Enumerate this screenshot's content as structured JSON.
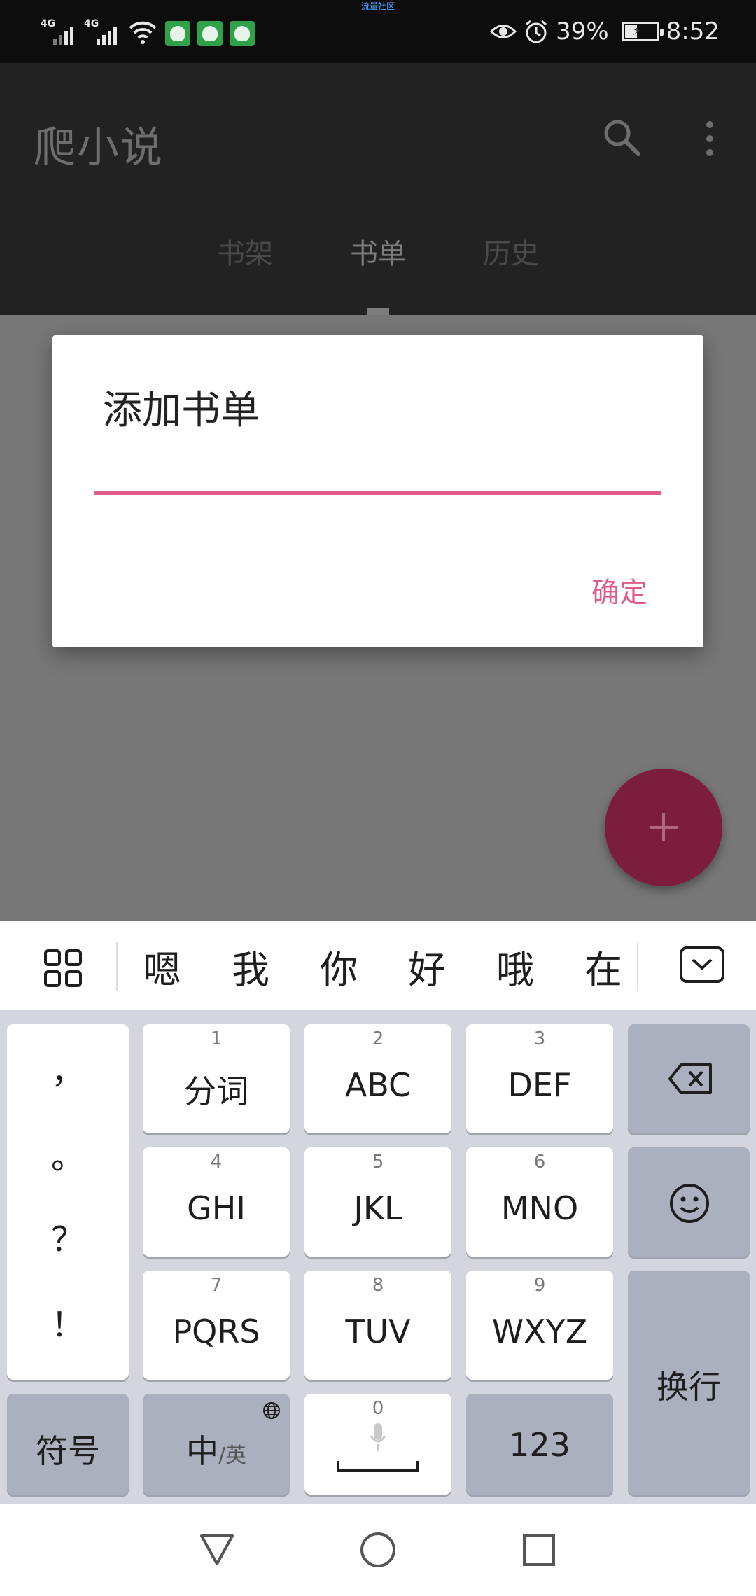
{
  "status_bar": {
    "network_1": "4G",
    "network_2": "4G",
    "center_text": "流量社区",
    "battery": "39%",
    "battery_level": 0.39,
    "time": "8:52"
  },
  "app_bar": {
    "title": "爬小说",
    "tabs": [
      {
        "label": "书架",
        "active": false
      },
      {
        "label": "书单",
        "active": true
      },
      {
        "label": "历史",
        "active": false
      }
    ]
  },
  "dialog": {
    "title": "添加书单",
    "input_value": "",
    "ok_label": "确定",
    "accent_color": "#e05a8a"
  },
  "ime": {
    "candidates": [
      "嗯",
      "我",
      "你",
      "好",
      "哦",
      "在"
    ],
    "punctuation": [
      "，",
      "。",
      "？",
      "！"
    ],
    "keys": [
      {
        "num": "1",
        "label": "分词"
      },
      {
        "num": "2",
        "label": "ABC"
      },
      {
        "num": "3",
        "label": "DEF"
      },
      {
        "num": "4",
        "label": "GHI"
      },
      {
        "num": "5",
        "label": "JKL"
      },
      {
        "num": "6",
        "label": "MNO"
      },
      {
        "num": "7",
        "label": "PQRS"
      },
      {
        "num": "8",
        "label": "TUV"
      },
      {
        "num": "9",
        "label": "WXYZ"
      }
    ],
    "symbols_label": "符号",
    "lang_main": "中",
    "lang_alt": "/英",
    "space_num": "0",
    "numeric_label": "123",
    "enter_label": "换行"
  },
  "icons": {
    "search": "search-icon",
    "more": "more-vert-icon",
    "fab": "plus-icon",
    "grid": "grid-icon",
    "collapse": "keyboard-collapse-icon",
    "backspace": "backspace-icon",
    "emoji": "smile-icon",
    "mic": "mic-icon",
    "globe": "globe-icon",
    "nav_back": "triangle-back-icon",
    "nav_home": "circle-home-icon",
    "nav_recent": "square-recent-icon"
  }
}
